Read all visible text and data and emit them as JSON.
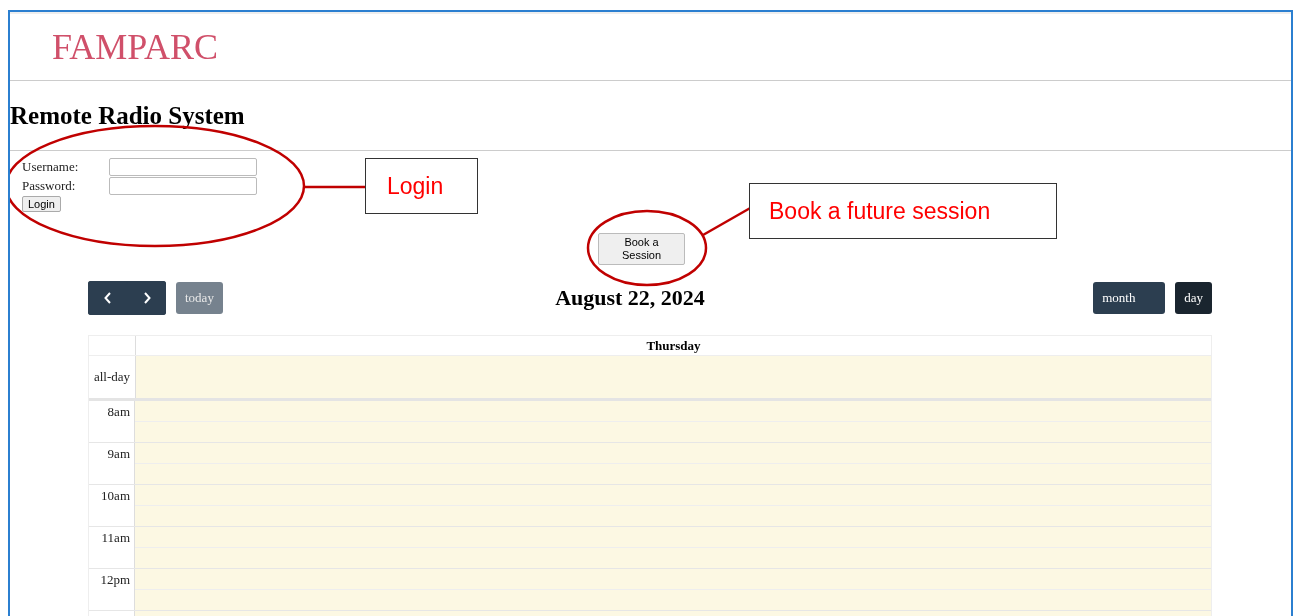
{
  "header": {
    "brand": "FAMPARC"
  },
  "title": "Remote Radio System",
  "login": {
    "fields": [
      {
        "label": "Username:"
      },
      {
        "label": "Password:"
      }
    ],
    "button": "Login"
  },
  "book_button": "Book a Session",
  "calendar": {
    "title": "August 22, 2024",
    "today": {
      "label": "today",
      "disabled": true
    },
    "views": [
      {
        "label": "month",
        "selected": false
      },
      {
        "label": "day",
        "selected": true
      }
    ],
    "day_header": "Thursday",
    "all_day_label": "all-day",
    "slots": [
      "8am",
      "9am",
      "10am",
      "11am",
      "12pm"
    ]
  },
  "annotations": [
    {
      "text": "Login"
    },
    {
      "text": "Book a future session"
    }
  ]
}
